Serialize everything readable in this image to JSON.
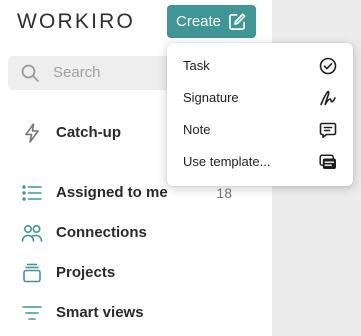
{
  "app": {
    "logo_text": "WORKIRO"
  },
  "header": {
    "create_label": "Create",
    "create_icon": "edit-square-icon",
    "accent_color": "#3f9695"
  },
  "search": {
    "placeholder": "Search",
    "icon": "search-icon"
  },
  "sidebar": {
    "items": [
      {
        "label": "Catch-up",
        "icon": "lightning-icon"
      },
      {
        "label": "Assigned to me",
        "icon": "list-icon",
        "count": "18"
      },
      {
        "label": "Connections",
        "icon": "people-icon"
      },
      {
        "label": "Projects",
        "icon": "stack-icon"
      },
      {
        "label": "Smart views",
        "icon": "filter-lines-icon"
      }
    ]
  },
  "create_menu": {
    "items": [
      {
        "label": "Task",
        "icon": "check-circle-icon"
      },
      {
        "label": "Signature",
        "icon": "signature-icon"
      },
      {
        "label": "Note",
        "icon": "comment-icon"
      },
      {
        "label": "Use template...",
        "icon": "template-icon"
      }
    ]
  }
}
